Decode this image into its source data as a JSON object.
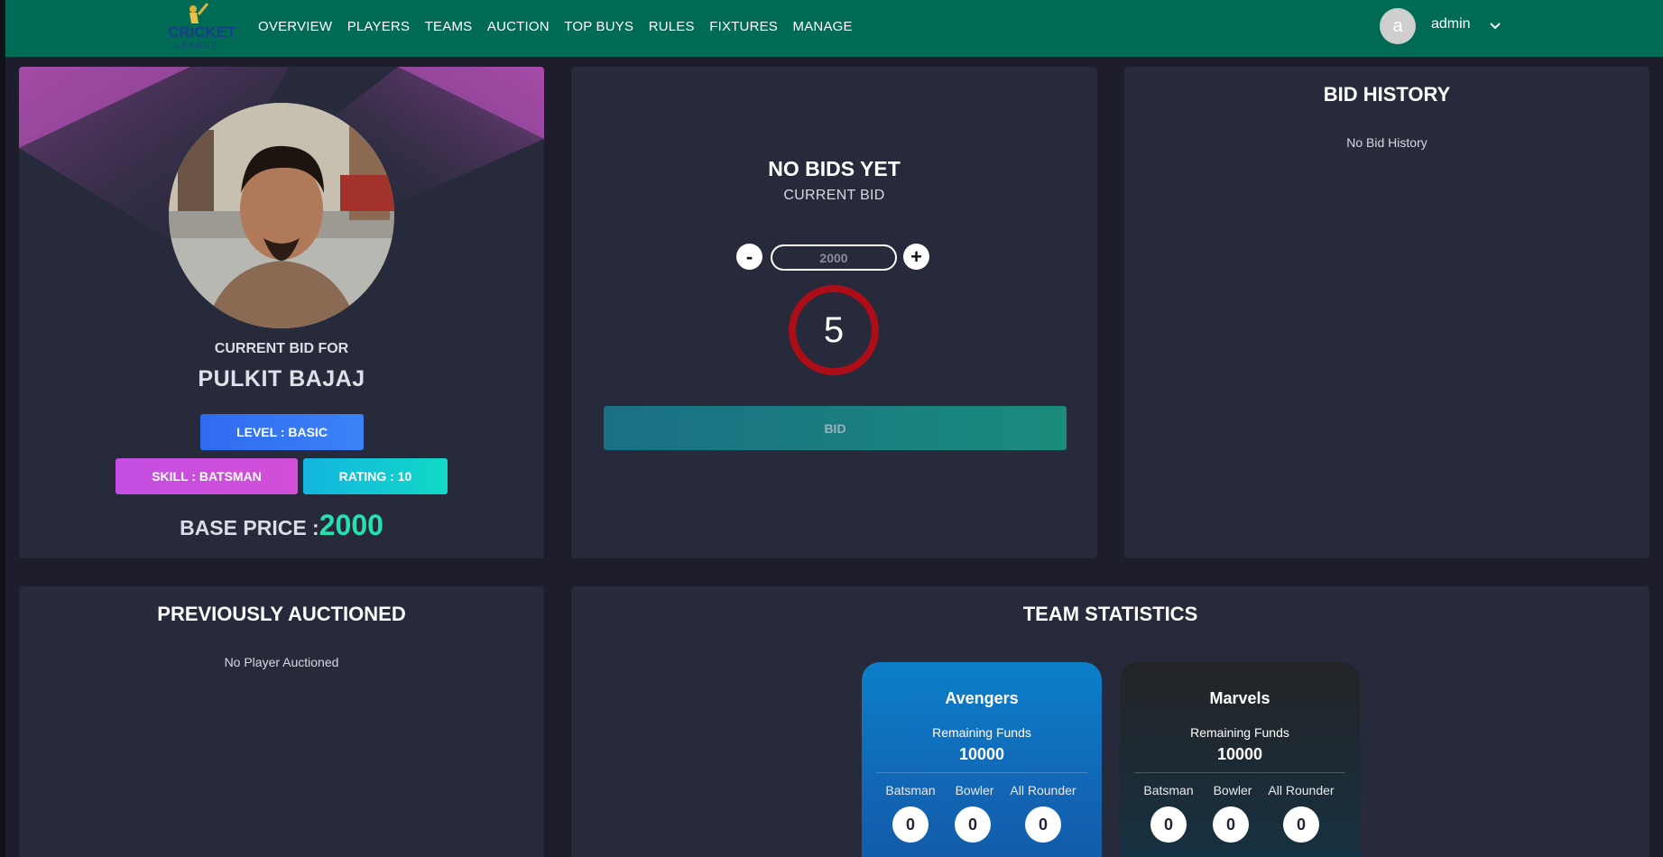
{
  "nav": {
    "logo_text": "CRICKET LEAGUE",
    "links": [
      "OVERVIEW",
      "PLAYERS",
      "TEAMS",
      "AUCTION",
      "TOP BUYS",
      "RULES",
      "FIXTURES",
      "MANAGE"
    ],
    "user_initial": "a",
    "user_name": "admin"
  },
  "player": {
    "current_bid_for_label": "CURRENT BID FOR",
    "name": "PULKIT BAJAJ",
    "level": "LEVEL : BASIC",
    "skill": "SKILL : BATSMAN",
    "rating": "RATING : 10",
    "base_price_label": "BASE PRICE :",
    "base_price_value": "2000"
  },
  "bid": {
    "status": "NO BIDS YET",
    "current_bid_label": "CURRENT BID",
    "minus_label": "-",
    "plus_label": "+",
    "amount_value": "2000",
    "timer": "5",
    "bid_button": "BID"
  },
  "history": {
    "title": "BID HISTORY",
    "empty": "No Bid History"
  },
  "previous": {
    "title": "PREVIOUSLY AUCTIONED",
    "empty": "No Player Auctioned"
  },
  "team_stats": {
    "title": "TEAM STATISTICS",
    "teams": [
      {
        "name": "Avengers",
        "remaining_label": "Remaining Funds",
        "remaining_value": "10000",
        "stats": [
          {
            "label": "Batsman",
            "value": "0"
          },
          {
            "label": "Bowler",
            "value": "0"
          },
          {
            "label": "All Rounder",
            "value": "0"
          }
        ]
      },
      {
        "name": "Marvels",
        "remaining_label": "Remaining Funds",
        "remaining_value": "10000",
        "stats": [
          {
            "label": "Batsman",
            "value": "0"
          },
          {
            "label": "Bowler",
            "value": "0"
          },
          {
            "label": "All Rounder",
            "value": "0"
          }
        ]
      }
    ]
  },
  "colors": {
    "navbar": "#006b55",
    "card": "#272a3b",
    "page": "#1d1d2b",
    "base_price": "#22e2b0",
    "timer_ring": "#ad0d16"
  }
}
